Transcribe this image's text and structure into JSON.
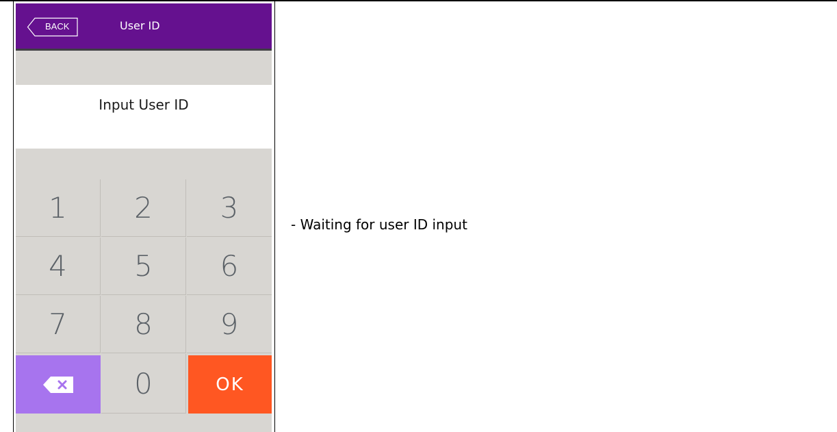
{
  "header": {
    "back_label": "BACK",
    "title": "User ID"
  },
  "prompt": {
    "text": "Input User ID"
  },
  "keypad": {
    "keys": [
      {
        "label": "1"
      },
      {
        "label": "2"
      },
      {
        "label": "3"
      },
      {
        "label": "4"
      },
      {
        "label": "5"
      },
      {
        "label": "6"
      },
      {
        "label": "7"
      },
      {
        "label": "8"
      },
      {
        "label": "9"
      }
    ],
    "backspace_icon": "backspace-icon",
    "zero_label": "0",
    "ok_label": "OK"
  },
  "description": "- Waiting for user ID input",
  "colors": {
    "header": "#65118f",
    "backspace_key": "#a774ee",
    "ok_key": "#ff5722",
    "keypad_bg": "#d8d6d2"
  }
}
